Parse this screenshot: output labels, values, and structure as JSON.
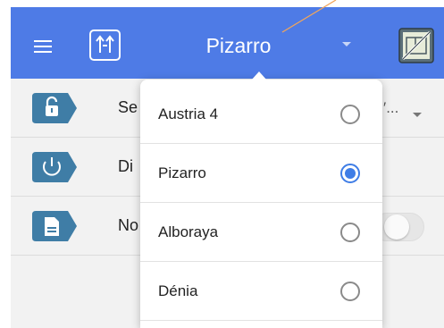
{
  "colors": {
    "appbar": "#4e7be6",
    "icon_teal": "#3f7da6",
    "radio_selected": "#3f7de6",
    "pointer_line": "#f2a65a"
  },
  "appbar": {
    "title": "Pizarro",
    "menu_icon": "hamburger-icon",
    "sort_icon": "sort-arrows-icon",
    "plan_icon": "floorplan-icon"
  },
  "list": {
    "rows": [
      {
        "label": "Se",
        "value": "′...",
        "icon": "padlock-open-icon"
      },
      {
        "label": "Di",
        "icon": "power-icon"
      },
      {
        "label": "No",
        "icon": "document-icon"
      }
    ]
  },
  "dropdown": {
    "options": [
      {
        "label": "Austria 4",
        "selected": false
      },
      {
        "label": "Pizarro",
        "selected": true
      },
      {
        "label": "Alboraya",
        "selected": false
      },
      {
        "label": "Dénia",
        "selected": false
      }
    ]
  }
}
